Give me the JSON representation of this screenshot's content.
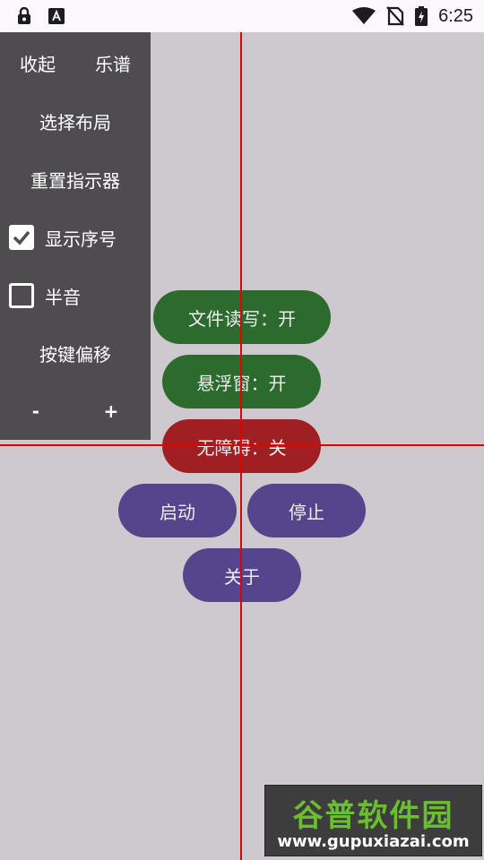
{
  "status_bar": {
    "time": "6:25",
    "left_icons": [
      "lock-icon",
      "font-a-icon"
    ],
    "right_icons": [
      "wifi-icon",
      "no-sim-icon",
      "battery-charging-icon"
    ]
  },
  "panel": {
    "collapse": "收起",
    "score": "乐谱",
    "select_layout": "选择布局",
    "reset_indicator": "重置指示器",
    "show_index": {
      "label": "显示序号",
      "checked": true
    },
    "semitone": {
      "label": "半音",
      "checked": false
    },
    "key_offset": "按键偏移",
    "minus": "-",
    "plus": "+"
  },
  "buttons": {
    "file_rw": "文件读写：开",
    "floating_window": "悬浮窗：开",
    "accessibility": "无障碍：关",
    "start": "启动",
    "stop": "停止",
    "about": "关于"
  },
  "colors": {
    "on": "#2c6a2e",
    "off": "#9f1f23",
    "action": "#56448c",
    "crosshair": "#e00000",
    "panel": "#4f4c50",
    "background": "#cdc9ce"
  },
  "watermark": {
    "title": "谷普软件园",
    "url": "www.gupuxiazai.com"
  }
}
